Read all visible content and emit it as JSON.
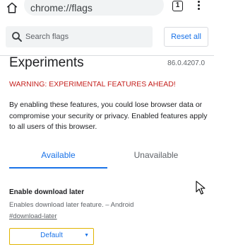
{
  "browser": {
    "url": "chrome://flags",
    "tab_count": "1"
  },
  "search": {
    "placeholder": "Search flags",
    "value": ""
  },
  "header": {
    "reset_label": "Reset all"
  },
  "main": {
    "title": "Experiments",
    "version": "86.0.4207.0",
    "warning": "WARNING: EXPERIMENTAL FEATURES AHEAD!",
    "intro": "By enabling these features, you could lose browser data or compromise your security or privacy. Enabled features apply to all users of this browser."
  },
  "tabs": [
    {
      "label": "Available",
      "selected": true
    },
    {
      "label": "Unavailable",
      "selected": false
    }
  ],
  "experiments": [
    {
      "name": "Enable download later",
      "description": "Enables download later feature. – Android",
      "link": "#download-later",
      "selected_option": "Default"
    }
  ],
  "colors": {
    "accent": "#1a73e8",
    "warning": "#c5221f",
    "select_border": "#e0b400"
  },
  "icons": {
    "home": "home-icon",
    "search": "search-icon",
    "menu": "more-vert-icon",
    "cursor": "mouse-pointer-icon"
  }
}
